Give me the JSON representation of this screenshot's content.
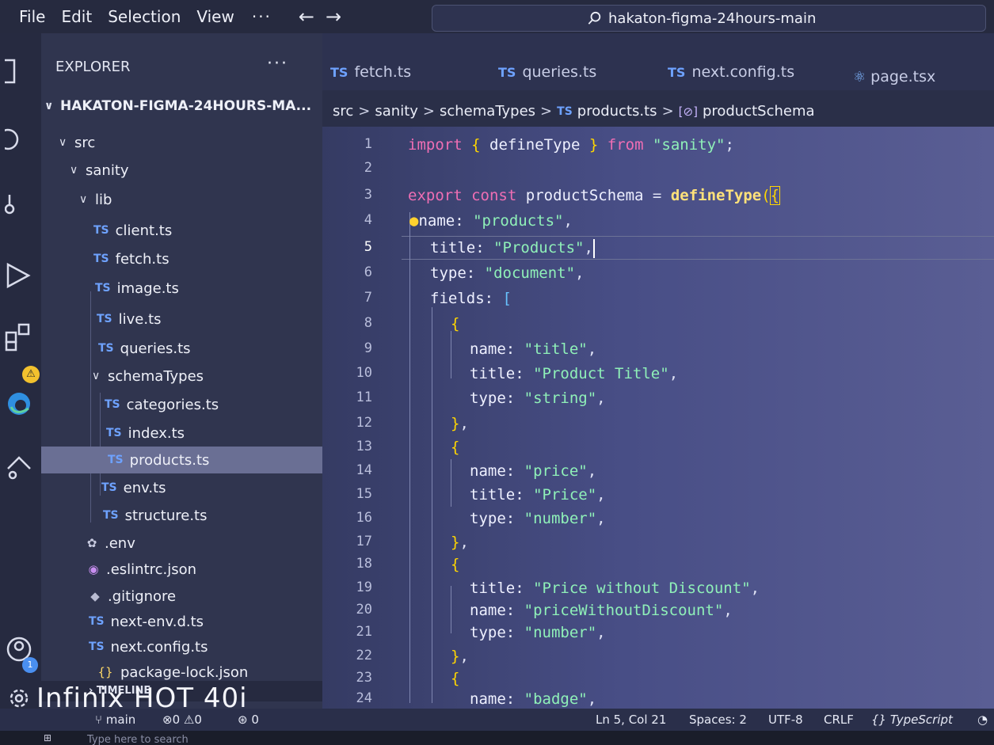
{
  "menu": {
    "items": [
      "File",
      "Edit",
      "Selection",
      "View"
    ],
    "more": "···",
    "back": "←",
    "forward": "→"
  },
  "search": {
    "value": "hakaton-figma-24hours-main"
  },
  "explorer": {
    "header": "EXPLORER",
    "more": "···",
    "root": "HAKATON-FIGMA-24HOURS-MA...",
    "tree": [
      {
        "label": "src",
        "kind": "folder"
      },
      {
        "label": "sanity",
        "kind": "folder"
      },
      {
        "label": "lib",
        "kind": "folder"
      },
      {
        "label": "client.ts",
        "kind": "ts"
      },
      {
        "label": "fetch.ts",
        "kind": "ts"
      },
      {
        "label": "image.ts",
        "kind": "ts"
      },
      {
        "label": "live.ts",
        "kind": "ts"
      },
      {
        "label": "queries.ts",
        "kind": "ts"
      },
      {
        "label": "schemaTypes",
        "kind": "folder"
      },
      {
        "label": "categories.ts",
        "kind": "ts"
      },
      {
        "label": "index.ts",
        "kind": "ts"
      },
      {
        "label": "products.ts",
        "kind": "ts"
      },
      {
        "label": "env.ts",
        "kind": "ts"
      },
      {
        "label": "structure.ts",
        "kind": "ts"
      },
      {
        "label": ".env",
        "kind": "gear"
      },
      {
        "label": ".eslintrc.json",
        "kind": "eslint"
      },
      {
        "label": ".gitignore",
        "kind": "git"
      },
      {
        "label": "next-env.d.ts",
        "kind": "ts"
      },
      {
        "label": "next.config.ts",
        "kind": "ts"
      },
      {
        "label": "package-lock.json",
        "kind": "json"
      }
    ],
    "timeline": "TIMELINE"
  },
  "file_badges": {
    "ts": "TS",
    "gear": "✿",
    "eslint": "◉",
    "git": "◆",
    "json": "{}"
  },
  "tabs": [
    {
      "label": "fetch.ts",
      "kind": "TS"
    },
    {
      "label": "queries.ts",
      "kind": "TS"
    },
    {
      "label": "next.config.ts",
      "kind": "TS"
    },
    {
      "label": "page.tsx",
      "kind": "react"
    }
  ],
  "breadcrumb": {
    "parts": [
      "src",
      "sanity",
      "schemaTypes"
    ],
    "file_badge": "TS",
    "file": "products.ts",
    "symbol_icon": "[⊘]",
    "symbol": "productSchema",
    "sep": ">"
  },
  "editor": {
    "line_numbers": [
      "1",
      "2",
      "3",
      "4",
      "5",
      "6",
      "7",
      "8",
      "9",
      "10",
      "11",
      "12",
      "13",
      "14",
      "15",
      "16",
      "17",
      "18",
      "19",
      "20",
      "21",
      "22",
      "23",
      "24"
    ],
    "current_line": 5
  },
  "status": {
    "branch": "main",
    "errors": "0",
    "warnings": "0",
    "ports": "0",
    "position": "Ln 5, Col 21",
    "spaces": "Spaces: 2",
    "encoding": "UTF-8",
    "eol": "CRLF",
    "language": "TypeScript"
  },
  "activity": {
    "warning_badge": "⚠",
    "accounts_badge": "1"
  },
  "watermark": "Infinix HOT 40i",
  "taskbar": {
    "search_placeholder": "Type here to search"
  },
  "colors": {
    "keyword": "#ffd866",
    "string": "#8ff0b8",
    "ts_badge": "#6ea2ff",
    "selection": "#6a6f94"
  }
}
